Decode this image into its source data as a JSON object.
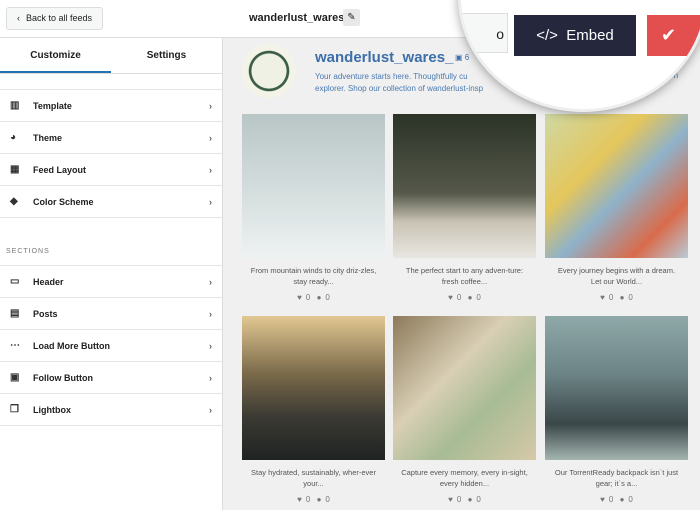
{
  "topbar": {
    "back_label": "Back to all feeds",
    "feed_name": "wanderlust_wares_",
    "embed_label": "Embed"
  },
  "sidebar": {
    "tabs": [
      "Customize",
      "Settings"
    ],
    "items": [
      {
        "label": "Template",
        "icon": "template-icon"
      },
      {
        "label": "Theme",
        "icon": "palette-icon"
      },
      {
        "label": "Feed Layout",
        "icon": "layout-icon"
      },
      {
        "label": "Color Scheme",
        "icon": "paint-bucket-icon"
      }
    ],
    "section_title": "SECTIONS",
    "sections": [
      {
        "label": "Header",
        "icon": "header-icon"
      },
      {
        "label": "Posts",
        "icon": "posts-icon"
      },
      {
        "label": "Load More Button",
        "icon": "load-more-icon"
      },
      {
        "label": "Follow Button",
        "icon": "follow-icon"
      },
      {
        "label": "Lightbox",
        "icon": "lightbox-icon"
      }
    ]
  },
  "profile": {
    "username": "wanderlust_wares_",
    "post_count": "6",
    "bio_line1": "Your adventure starts here. Thoughtfully cu",
    "bio_line1_end": "dern",
    "bio_line2": "explorer. Shop our collection of wanderlust-insp"
  },
  "posts": [
    {
      "caption": "From mountain winds to city driz-zles, stay ready...",
      "likes": "0",
      "comments": "0",
      "bg": "linear-gradient(180deg,#b9c6c6,#d8e0e0 60%,#eef2f3)"
    },
    {
      "caption": "The perfect start to any adven-ture: fresh coffee...",
      "likes": "0",
      "comments": "0",
      "bg": "linear-gradient(180deg,#2b3327,#55584a 55%,#c9c3b4 75%,#e8e6e1)"
    },
    {
      "caption": "Every journey begins with a dream. Let our World...",
      "likes": "0",
      "comments": "0",
      "bg": "linear-gradient(135deg,#cfd8a3,#e4c65c 35%,#8fb2c9 55%,#d96b4b 80%,#b9cbd6)"
    },
    {
      "caption": "Stay hydrated, sustainably, wher-ever your...",
      "likes": "0",
      "comments": "0",
      "bg": "linear-gradient(180deg,#e2c892,#7a6a4a 40%,#3b3a33 70%,#1f2322)"
    },
    {
      "caption": "Capture every memory, every in-sight, every hidden...",
      "likes": "0",
      "comments": "0",
      "bg": "linear-gradient(135deg,#8d7a5a,#d9cfb5 40%,#a7bb94 65%,#d6c9a8)"
    },
    {
      "caption": "Our TorrentReady backpack isn`t just gear; it`s a...",
      "likes": "0",
      "comments": "0",
      "bg": "linear-gradient(180deg,#8fa8a8,#6d8486 40%,#3b4749 75%,#a4b5b0)"
    }
  ]
}
